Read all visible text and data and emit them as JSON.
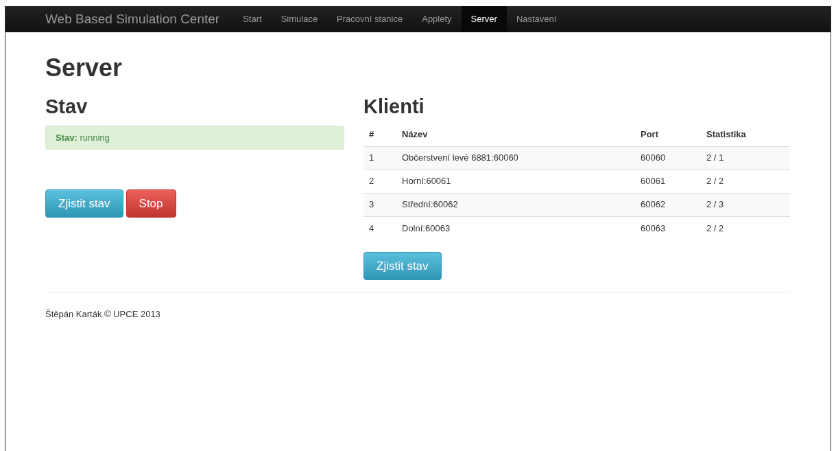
{
  "navbar": {
    "brand": "Web Based Simulation Center",
    "items": [
      {
        "label": "Start",
        "selected": false
      },
      {
        "label": "Simulace",
        "selected": false
      },
      {
        "label": "Pracovní stanice",
        "selected": false
      },
      {
        "label": "Applety",
        "selected": false
      },
      {
        "label": "Server",
        "selected": true
      },
      {
        "label": "Nastavení",
        "selected": false
      }
    ]
  },
  "page_title": "Server",
  "status_panel": {
    "heading": "Stav",
    "alert": "**Stav:** running",
    "buttons": [
      {
        "label": "Zjistit stav",
        "kind": "info"
      },
      {
        "label": "Stop",
        "kind": "danger"
      }
    ]
  },
  "clients_panel": {
    "heading": "Klienti",
    "table": {
      "columns": [
        "#",
        "Název",
        "Port",
        "Statistika"
      ],
      "rows": [
        [
          "1",
          "Občerstvení levé 6881:60060",
          "60060",
          "2 / 1"
        ],
        [
          "2",
          "Horní:60061",
          "60061",
          "2 / 2"
        ],
        [
          "3",
          "Střední:60062",
          "60062",
          "2 / 3"
        ],
        [
          "4",
          "Dolní:60063",
          "60063",
          "2 / 2"
        ]
      ]
    },
    "buttons": [
      {
        "label": "Zjistit stav",
        "kind": "info"
      }
    ]
  },
  "footer": "Štěpán Karták © UPCE 2013"
}
